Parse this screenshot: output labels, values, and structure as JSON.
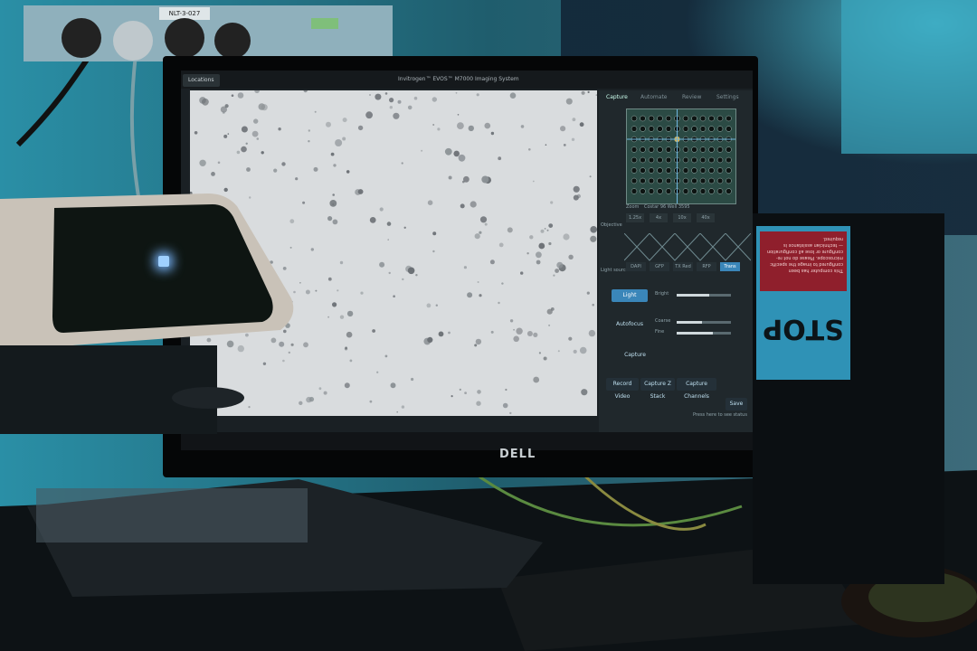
{
  "app": {
    "window_title": "Invitrogen™ EVOS™ M7000 Imaging System",
    "locations_tab": "Locations",
    "tabs": [
      "Capture",
      "Automate",
      "Review",
      "Settings"
    ],
    "objective_label": "Objective",
    "objectives": [
      "1.25x",
      "4x",
      "10x",
      "40x"
    ],
    "light_source_label": "Light source",
    "channels": [
      "DAPI",
      "GFP",
      "TX Red",
      "RFP",
      "Trans"
    ],
    "light_button": "Light",
    "brightness_label": "Bright",
    "autofocus_button": "Autofocus",
    "coarse_label": "Coarse",
    "fine_label": "Fine",
    "capture_button": "Capture",
    "record_video_button": "Record Video",
    "capture_zstack_button": "Capture Z Stack",
    "capture_channels_button": "Capture Channels",
    "save_button": "Save",
    "vessel_label": "Costar 96 Well 3595",
    "zoom_label": "Zoom",
    "status_text": "Press here to see status"
  },
  "monitor_brand": "DELL",
  "labels": {
    "outlet_tag": "NLT-3-027",
    "green_tag": "",
    "sign_top": "This computer has been configured to image the specific microscope. Please do not re-configure or lose all configuration — technician assistance is required.",
    "sign_stop": "STOP"
  },
  "colors": {
    "screen_bg": "#1a2024",
    "panel_bg": "#20282c",
    "accent_blue": "#3a86b9",
    "sign_blue": "#2f92b6",
    "sign_red": "#8f1f2c",
    "wall_teal": "#2aa6b8"
  }
}
